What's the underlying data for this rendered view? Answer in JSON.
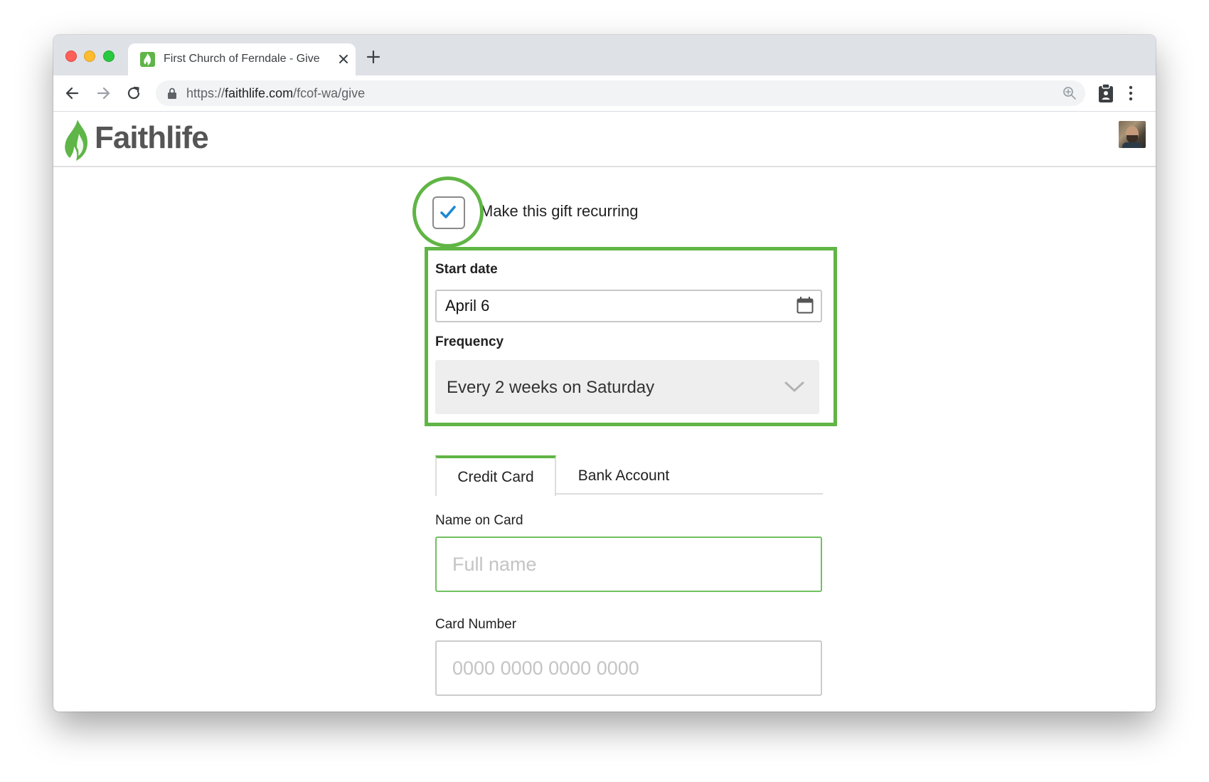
{
  "browser": {
    "tab_title": "First Church of Ferndale  - Give",
    "url_scheme": "https://",
    "url_domain": "faithlife.com",
    "url_path": "/fcof-wa/give"
  },
  "site": {
    "logo_text": "Faithlife"
  },
  "form": {
    "recurring_label": "Make this gift recurring",
    "recurring_checked": true,
    "start_date_label": "Start date",
    "start_date_value": "April 6",
    "frequency_label": "Frequency",
    "frequency_value": "Every 2 weeks on Saturday",
    "payment_tabs": [
      {
        "label": "Credit Card",
        "active": true
      },
      {
        "label": "Bank Account",
        "active": false
      }
    ],
    "name_on_card_label": "Name on Card",
    "name_on_card_placeholder": "Full name",
    "card_number_label": "Card Number",
    "card_number_placeholder": "0000 0000 0000 0000"
  },
  "colors": {
    "brand_green": "#60b545",
    "checkmark_blue": "#1e88d6"
  },
  "icons": [
    "close-icon",
    "plus-icon",
    "back-arrow-icon",
    "forward-arrow-icon",
    "reload-icon",
    "lock-icon",
    "zoom-icon",
    "clipboard-extension-icon",
    "more-vert-icon",
    "flame-logo-icon",
    "checkmark-icon",
    "calendar-icon",
    "chevron-down-icon"
  ]
}
